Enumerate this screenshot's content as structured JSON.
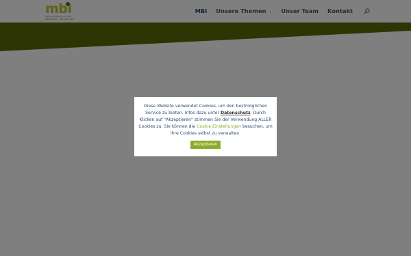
{
  "header": {
    "logo": {
      "word": "mbi",
      "sub_line_1": "MENSCHENBILDUNG",
      "sub_line_2": "BERATEN · BEGLEITEN"
    },
    "nav": {
      "items": [
        {
          "label": "MBI",
          "active": true,
          "has_dropdown": false
        },
        {
          "label": "Unsere Themen",
          "active": false,
          "has_dropdown": true
        },
        {
          "label": "Unser Team",
          "active": false,
          "has_dropdown": false
        },
        {
          "label": "Kontakt",
          "active": false,
          "has_dropdown": false
        }
      ],
      "dropdown_glyph": "⌄",
      "search_icon": "search-icon"
    }
  },
  "cookie_banner": {
    "text_part_1": "Diese Website verwendet Cookies, um den bestmöglichen Service zu bieten. Infos dazu unter ",
    "policy_link": "Datenschutz",
    "text_part_2": ". Durch Klicken auf \"Akzeptieren\" stimmen Sie der Verwendung ALLER Cookies zu. Sie können die ",
    "settings_link": "Cookie Einstellungen",
    "text_part_3": " besuchen, um Ihre Cookies selbst zu verwalten.",
    "accept_label": "Akzeptieren"
  },
  "colors": {
    "brand_green": "#8dab2a",
    "hero_olive": "#5a6a08",
    "nav_active": "#2a4a73",
    "nav_text": "#555555",
    "overlay": "rgba(0,0,0,0.5)"
  }
}
